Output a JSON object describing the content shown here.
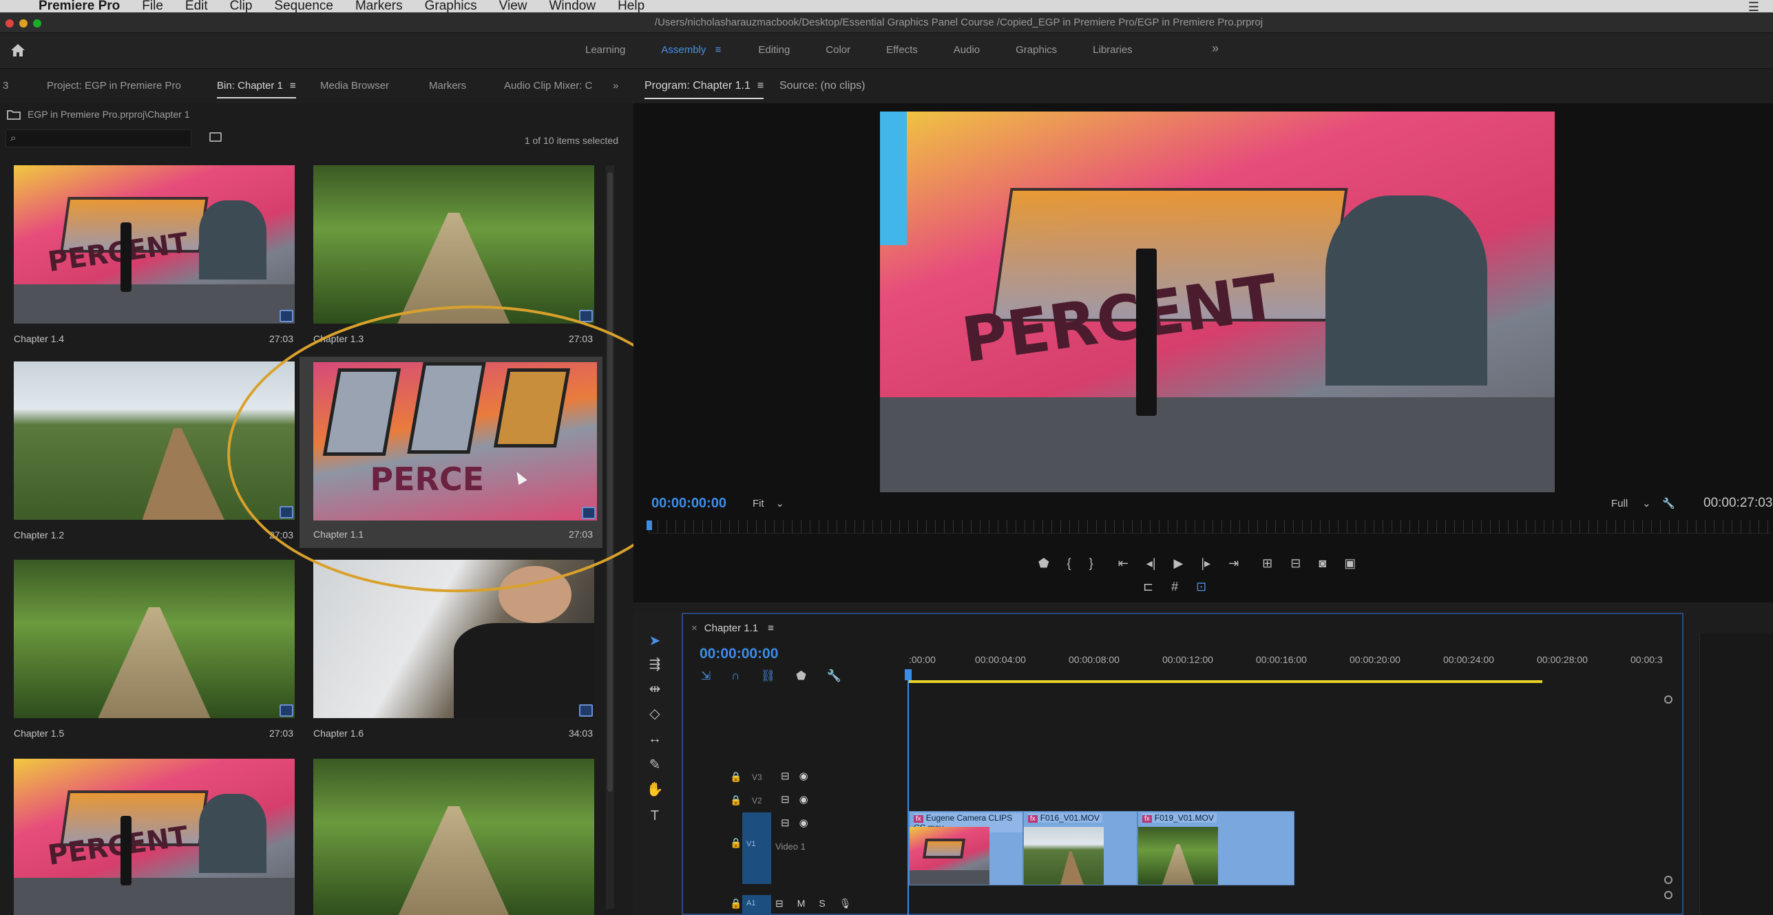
{
  "menubar": {
    "apple": "",
    "app": "Premiere Pro",
    "items": [
      "File",
      "Edit",
      "Clip",
      "Sequence",
      "Markers",
      "Graphics",
      "View",
      "Window",
      "Help"
    ]
  },
  "titlebar": {
    "path": "/Users/nicholasharauzmacbook/Desktop/Essential Graphics Panel Course /Copied_EGP in Premiere Pro/EGP in Premiere Pro.prproj"
  },
  "workspaces": {
    "items": [
      "Learning",
      "Assembly",
      "Editing",
      "Color",
      "Effects",
      "Audio",
      "Graphics",
      "Libraries"
    ],
    "active": "Assembly",
    "more": "»"
  },
  "project_tabs": {
    "number": "3",
    "project": "Project: EGP in Premiere Pro",
    "bin": "Bin: Chapter 1",
    "media": "Media Browser",
    "markers": "Markers",
    "audio": "Audio Clip Mixer: C",
    "more": "»",
    "hamb": "≡"
  },
  "bin": {
    "path": "EGP in Premiere Pro.prproj\\Chapter 1",
    "selection": "1 of 10 items selected",
    "search_placeholder": ""
  },
  "clips": [
    {
      "name": "Chapter 1.4",
      "duration": "27:03"
    },
    {
      "name": "Chapter 1.3",
      "duration": "27:03"
    },
    {
      "name": "Chapter 1.2",
      "duration": "27:03"
    },
    {
      "name": "Chapter 1.1",
      "duration": "27:03"
    },
    {
      "name": "Chapter 1.5",
      "duration": "27:03"
    },
    {
      "name": "Chapter 1.6",
      "duration": "34:03"
    }
  ],
  "program": {
    "tab": "Program: Chapter 1.1",
    "source": "Source: (no clips)",
    "timecode": "00:00:00:00",
    "fit": "Fit",
    "full": "Full",
    "duration": "00:00:27:03"
  },
  "timeline": {
    "tab": "Chapter 1.1",
    "close": "×",
    "timecode": "00:00:00:00",
    "ruler": [
      ":00:00",
      "00:00:04:00",
      "00:00:08:00",
      "00:00:12:00",
      "00:00:16:00",
      "00:00:20:00",
      "00:00:24:00",
      "00:00:28:00",
      "00:00:3"
    ],
    "tracks": {
      "v3": "V3",
      "v2": "V2",
      "v1": "V1",
      "a1": "A1",
      "video1": "Video 1"
    },
    "a1_controls": [
      "M",
      "S"
    ],
    "clips": [
      {
        "name": "Eugene Camera CLIPS CC.mov"
      },
      {
        "name": "F016_V01.MOV"
      },
      {
        "name": "F019_V01.MOV"
      }
    ],
    "fx": "fx"
  },
  "colors": {
    "accent": "#3d8de6",
    "highlight_ring": "#d9a12c",
    "clip_blue": "#7aa7de",
    "in_out_bar": "#e8d22a"
  }
}
